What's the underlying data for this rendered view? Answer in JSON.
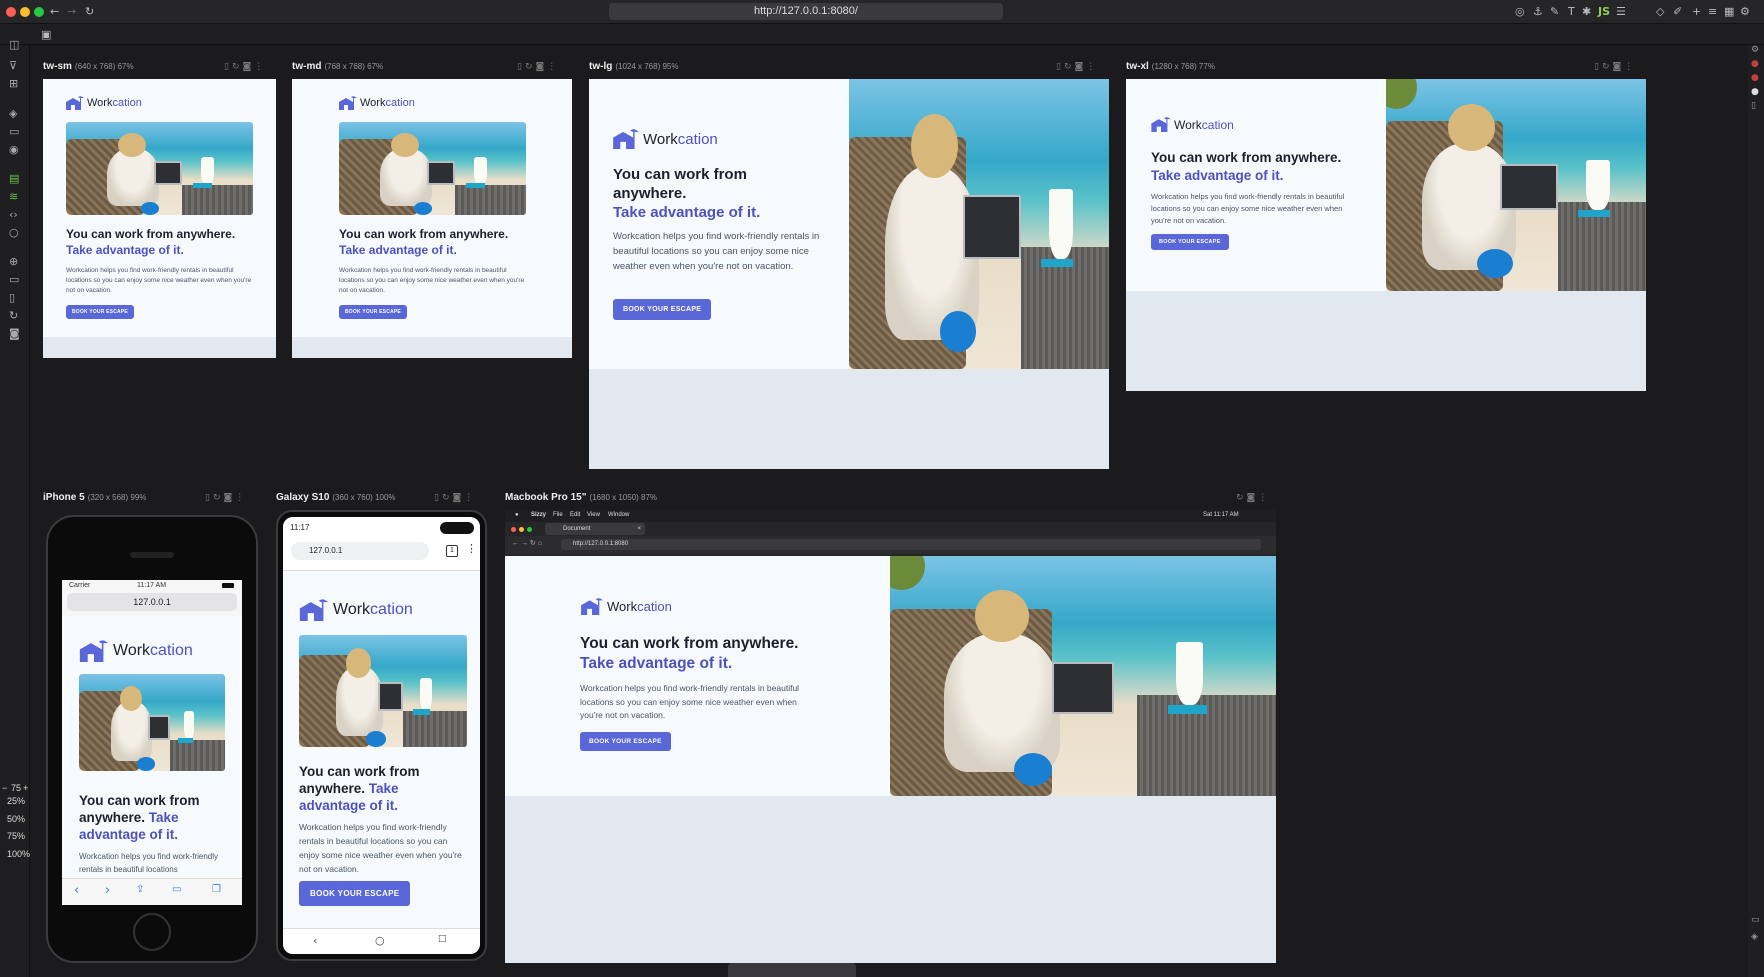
{
  "browser": {
    "url": "http://127.0.0.1:8080/"
  },
  "zoom_levels": {
    "current": "75",
    "plus": "+",
    "minus": "−",
    "z25": "25%",
    "z50": "50%",
    "z75": "75%",
    "z100": "100%"
  },
  "devices": [
    {
      "name": "tw-sm",
      "meta": "(640 x 768) 67%"
    },
    {
      "name": "tw-md",
      "meta": "(768 x 768) 67%"
    },
    {
      "name": "tw-lg",
      "meta": "(1024 x 768) 95%"
    },
    {
      "name": "tw-xl",
      "meta": "(1280 x 768) 77%"
    },
    {
      "name": "iPhone 5",
      "meta": "(320 x 568) 99%"
    },
    {
      "name": "Galaxy S10",
      "meta": "(360 x 760) 100%"
    },
    {
      "name": "Macbook Pro 15\"",
      "meta": "(1680 x 1050) 87%"
    }
  ],
  "site": {
    "logo_work": "Work",
    "logo_cation": "cation",
    "headline": "You can work from anywhere.",
    "headline_accent": "Take advantage of it.",
    "body": "Workcation helps you find work-friendly rentals in beautiful locations so you can enjoy some nice weather even when you're not on vacation.",
    "button": "Book your escape"
  },
  "iphone": {
    "carrier": "Carrier",
    "time": "11:17 AM",
    "url": "127.0.0.1",
    "body_clip": "Workcation helps you find work-friendly rentals in beautiful locations"
  },
  "galaxy": {
    "time": "11:17",
    "url": "127.0.0.1",
    "tabs": "1"
  },
  "mac": {
    "menu": [
      "Sizzy",
      "File",
      "Edit",
      "View",
      "Window"
    ],
    "clock": "Sat 11:17 AM",
    "tab": "Document",
    "url": "http://127.0.0.1:8080"
  }
}
